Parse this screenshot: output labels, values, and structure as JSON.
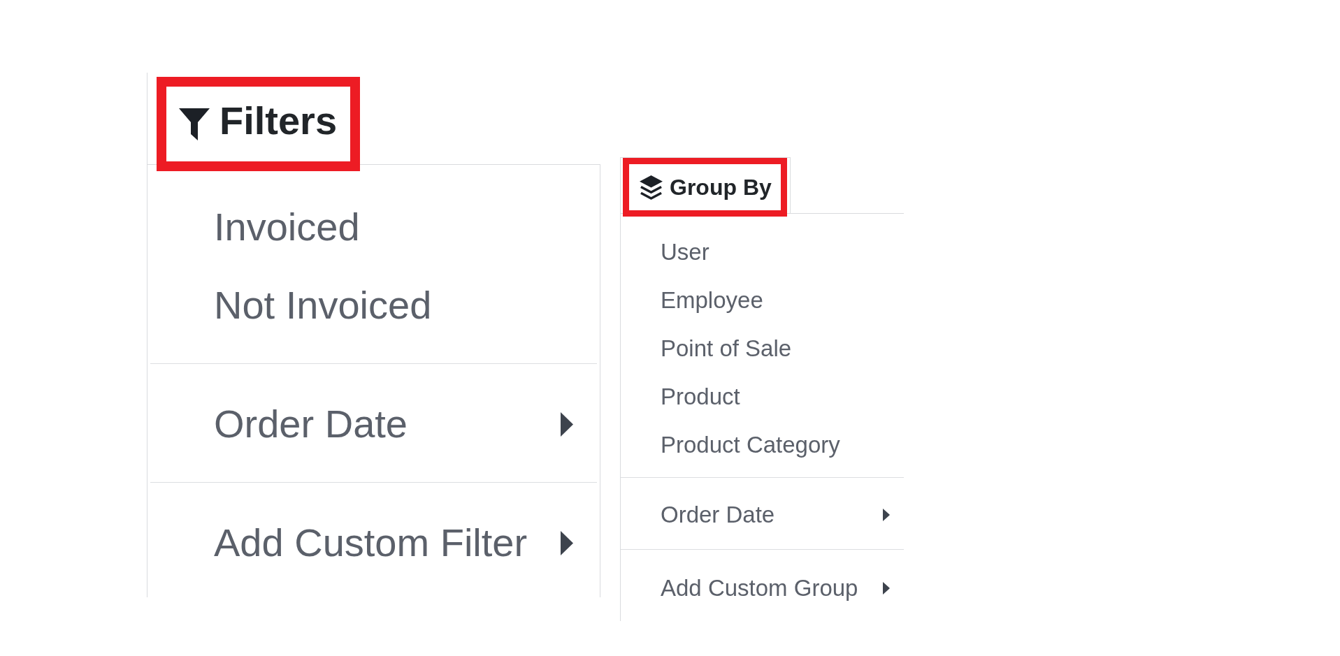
{
  "filters": {
    "label": "Filters",
    "highlighted": true,
    "sections": [
      {
        "items": [
          {
            "label": "Invoiced",
            "submenu": false
          },
          {
            "label": "Not Invoiced",
            "submenu": false
          }
        ]
      },
      {
        "items": [
          {
            "label": "Order Date",
            "submenu": true
          }
        ]
      },
      {
        "items": [
          {
            "label": "Add Custom Filter",
            "submenu": true
          }
        ]
      }
    ]
  },
  "group_by": {
    "label": "Group By",
    "highlighted": true,
    "sections": [
      {
        "items": [
          {
            "label": "User",
            "submenu": false
          },
          {
            "label": "Employee",
            "submenu": false
          },
          {
            "label": "Point of Sale",
            "submenu": false
          },
          {
            "label": "Product",
            "submenu": false
          },
          {
            "label": "Product Category",
            "submenu": false
          }
        ]
      },
      {
        "items": [
          {
            "label": "Order Date",
            "submenu": true
          }
        ]
      },
      {
        "items": [
          {
            "label": "Add Custom Group",
            "submenu": true
          }
        ]
      }
    ]
  }
}
